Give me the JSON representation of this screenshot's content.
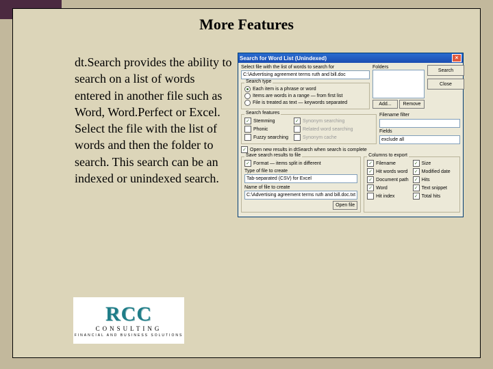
{
  "title": "More Features",
  "body_text": "dt.Search provides the ability to search on a list of words entered in another file such as Word, Word.Perfect or Excel.  Select the file with the list of words and then the folder to search.  This search can be an indexed or unindexed search.",
  "dialog": {
    "title": "Search for Word List (Unindexed)",
    "file_label": "Select file with the list of words to search for",
    "file_value": "C:\\Advertising agreement terms ruth and bill.doc",
    "folders_label": "Folders",
    "btn_search": "Search",
    "btn_close": "Close",
    "btn_add": "Add...",
    "btn_remove": "Remove",
    "search_type": {
      "caption": "Search type",
      "r1": "Each item is a phrase or word",
      "r2": "Items are words in a range — from first list",
      "r3": "File is treated as text — keywords separated"
    },
    "search_features": {
      "caption": "Search features",
      "c1": "Stemming",
      "c2": "Phonic",
      "c3": "Fuzzy searching",
      "c4": "Synonym searching",
      "c5": "Related word searching",
      "c6": "Synonym cache"
    },
    "filename_filter_label": "Filename filter",
    "filename_filter_value": "",
    "path_label": "Fields",
    "path_value": "exclude all",
    "open_results": "Open new results in dtSearch when search is complete",
    "save_results": {
      "caption": "Save search results to file",
      "format_label": "Format — items split in different",
      "type_label": "Type of file to create",
      "type_value": "Tab-separated (CSV) for Excel",
      "name_label": "Name of file to create",
      "name_value": "C:\\Advertising agreement terms ruth and bill.doc.txt",
      "btn_open": "Open file"
    },
    "columns": {
      "caption": "Columns to export",
      "c1": "Filename",
      "c2": "Hit words word",
      "c3": "Document path",
      "c4": "Word",
      "c5": "Hit index",
      "c6": "Size",
      "c7": "Modified date",
      "c8": "Hits",
      "c9": "Text snippet",
      "c10": "Total hits"
    }
  },
  "logo": {
    "line1": "RCC",
    "line2": "CONSULTING",
    "line3": "FINANCIAL AND BUSINESS SOLUTIONS"
  }
}
